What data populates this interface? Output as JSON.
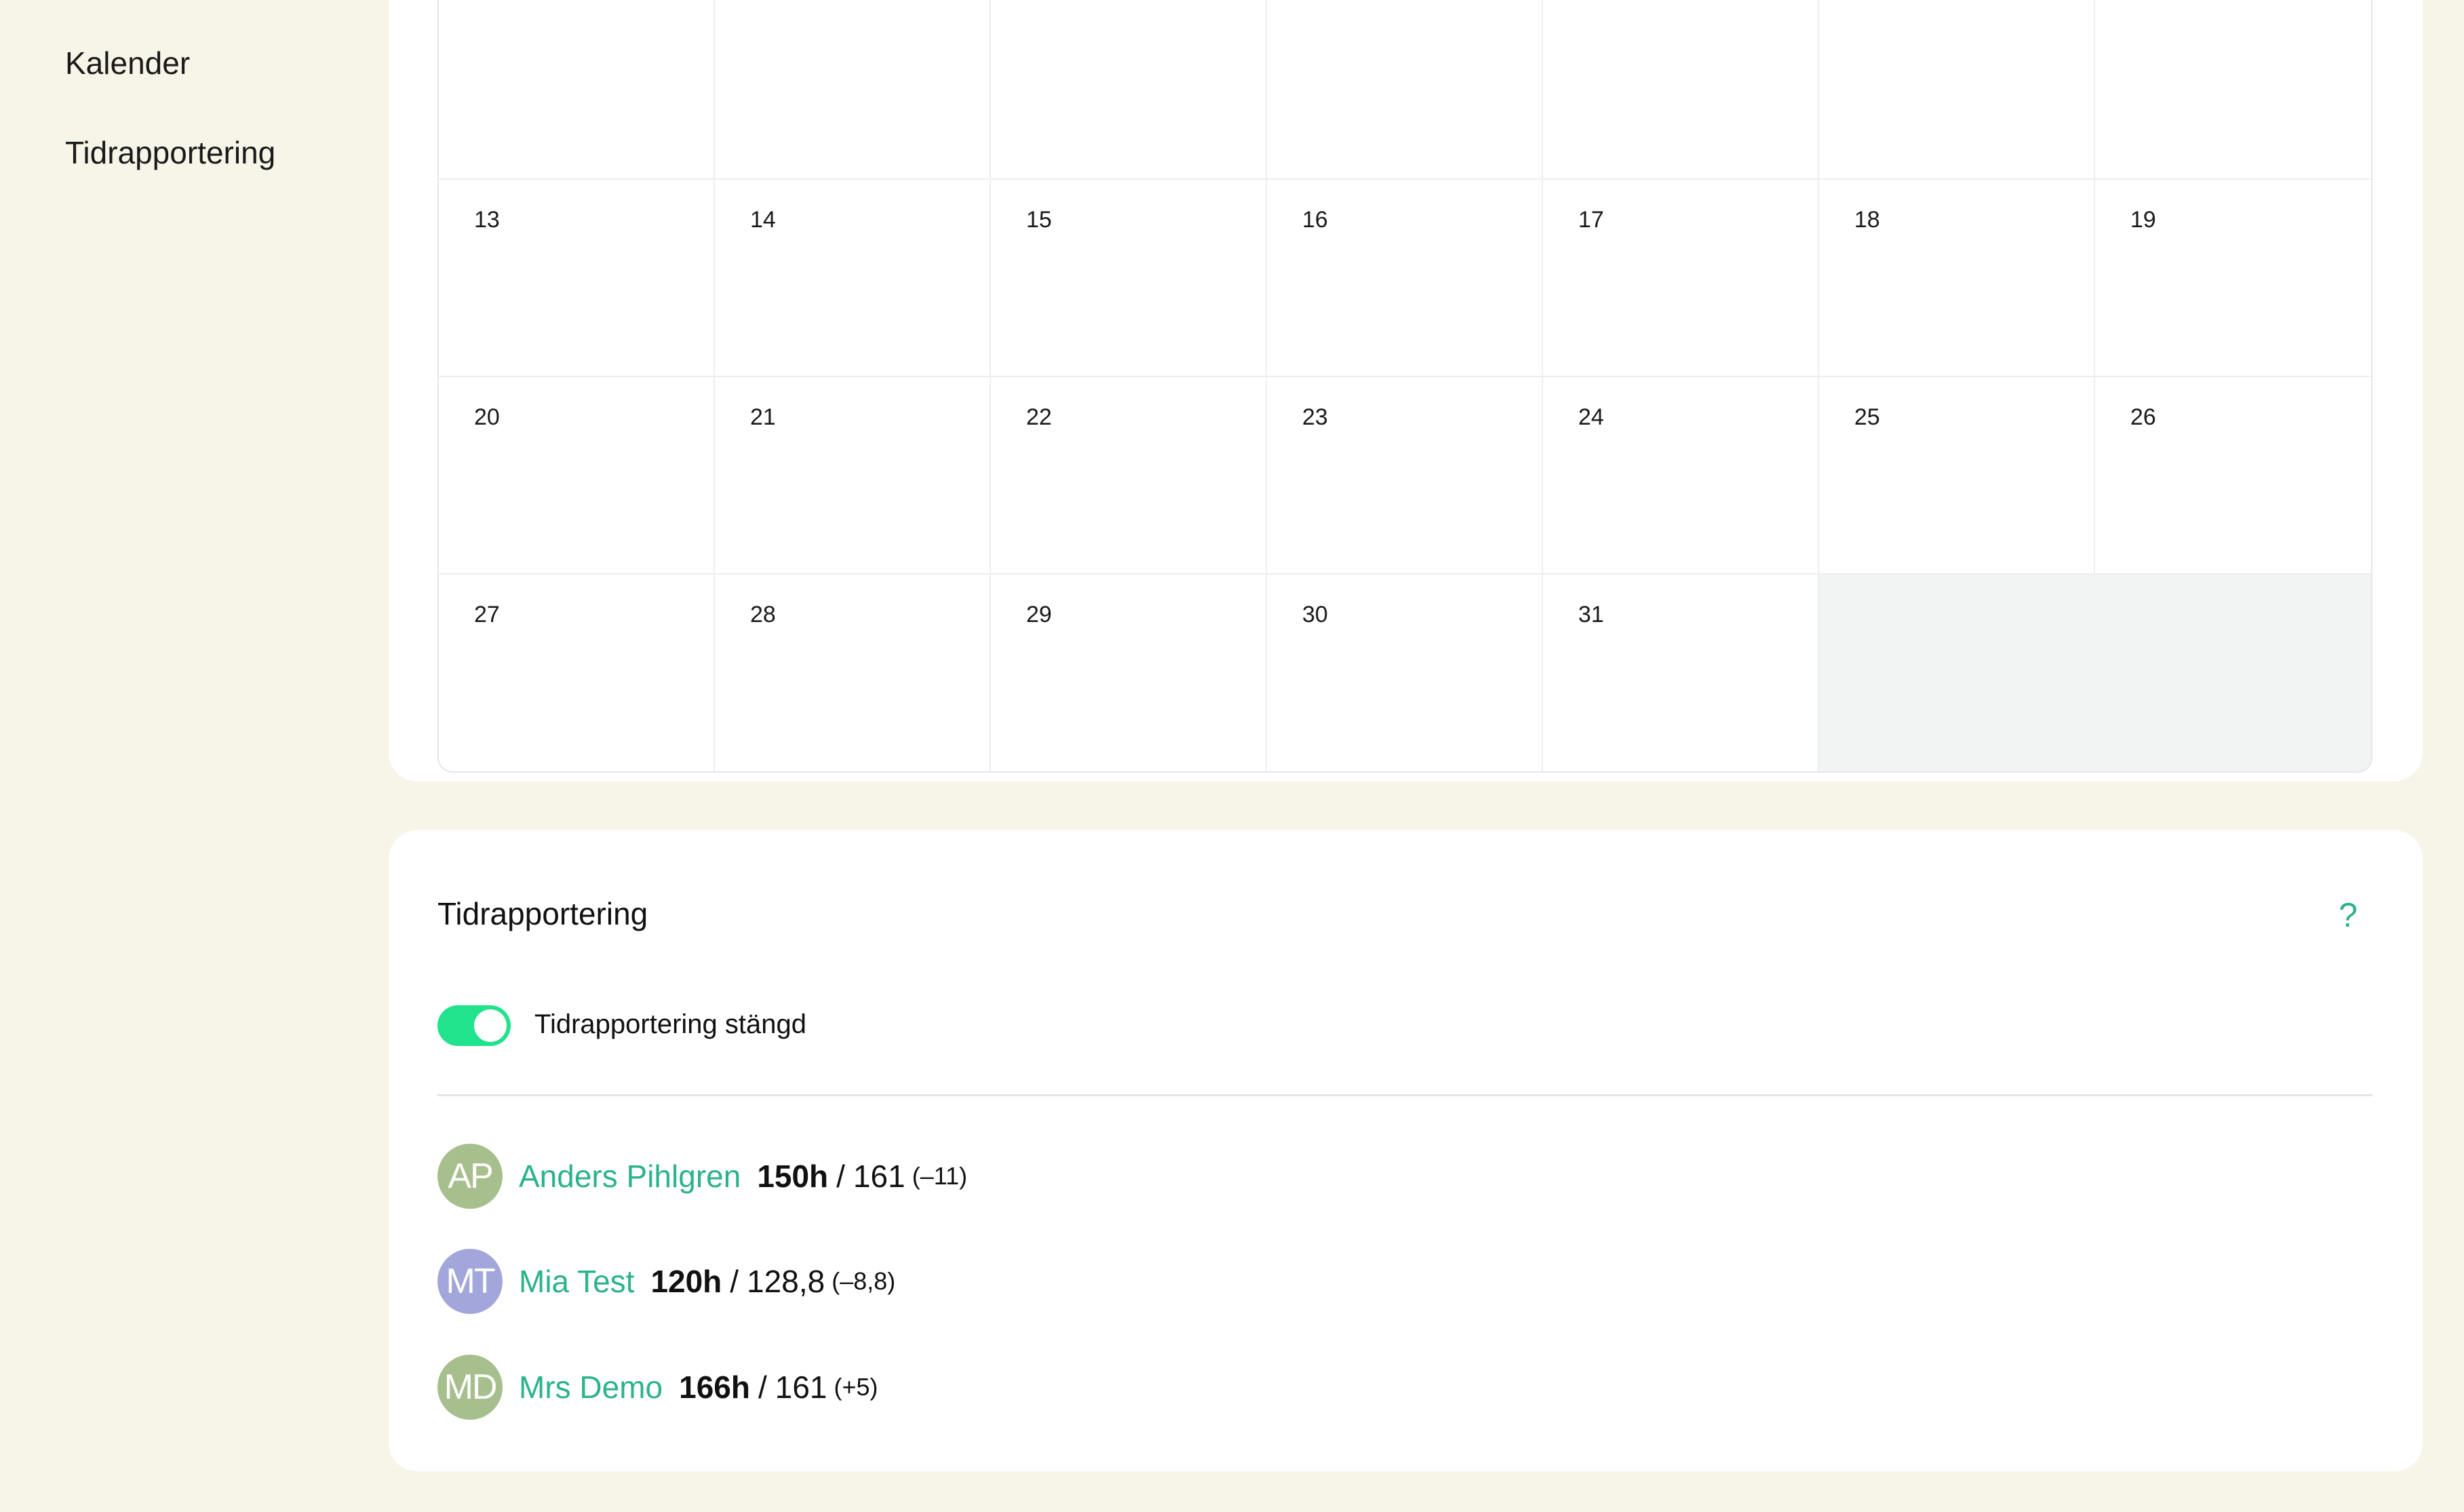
{
  "sidebar": {
    "items": [
      {
        "label": "Kalender"
      },
      {
        "label": "Tidrapportering"
      }
    ]
  },
  "calendar": {
    "weeks": [
      [
        "",
        "",
        "",
        "",
        "",
        "",
        ""
      ],
      [
        "13",
        "14",
        "15",
        "16",
        "17",
        "18",
        "19"
      ],
      [
        "20",
        "21",
        "22",
        "23",
        "24",
        "25",
        "26"
      ],
      [
        "27",
        "28",
        "29",
        "30",
        "31",
        "",
        ""
      ]
    ]
  },
  "time_report": {
    "title": "Tidrapportering",
    "help_icon": "?",
    "toggle_label": "Tidrapportering stängd",
    "toggle_on": true,
    "people": [
      {
        "initials": "AP",
        "name": "Anders Pihlgren",
        "hours": "150h",
        "slash": "/",
        "target": "161",
        "diff": "(–11)",
        "avatar_color": "#a7bf8d"
      },
      {
        "initials": "MT",
        "name": "Mia Test",
        "hours": "120h",
        "slash": "/",
        "target": "128,8",
        "diff": "(–8,8)",
        "avatar_color": "#a3a6da"
      },
      {
        "initials": "MD",
        "name": "Mrs Demo",
        "hours": "166h",
        "slash": "/",
        "target": "161",
        "diff": "(+5)",
        "avatar_color": "#a7bf8d"
      }
    ]
  },
  "colors": {
    "background": "#f7f4e8",
    "accent": "#2bb38a",
    "toggle": "#20e38c"
  }
}
